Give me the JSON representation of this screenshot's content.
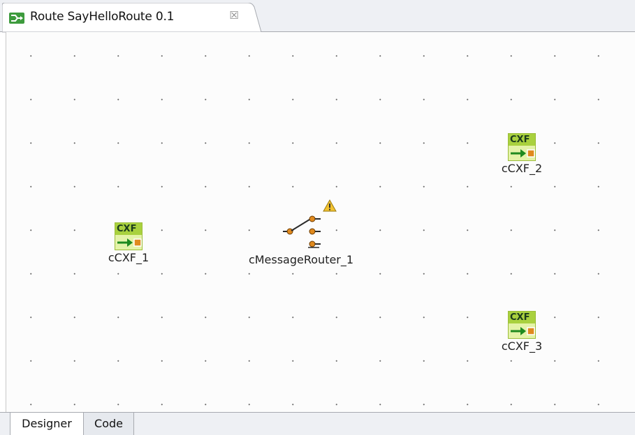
{
  "editor_tab": {
    "title": "Route SayHelloRoute 0.1",
    "icon": "route-icon",
    "close_icon": "close-icon",
    "close_glyph": "☒"
  },
  "canvas": {
    "components": [
      {
        "id": "cCXF_1",
        "type_label": "CXF",
        "label": "cCXF_1",
        "icon": "cxf-component-icon"
      },
      {
        "id": "cCXF_2",
        "type_label": "CXF",
        "label": "cCXF_2",
        "icon": "cxf-component-icon"
      },
      {
        "id": "cCXF_3",
        "type_label": "CXF",
        "label": "cCXF_3",
        "icon": "cxf-component-icon"
      }
    ],
    "router": {
      "label": "cMessageRouter_1",
      "icon": "message-router-icon",
      "status_icon": "warning-icon"
    }
  },
  "bottom_tabs": [
    {
      "label": "Designer",
      "selected": true
    },
    {
      "label": "Code",
      "selected": false
    }
  ],
  "colors": {
    "cxf_header": "#a9d13e",
    "cxf_body": "#e4f3a8",
    "arrow": "#1f8a1f",
    "port": "#e08a1e",
    "warning": "#f2c230"
  }
}
